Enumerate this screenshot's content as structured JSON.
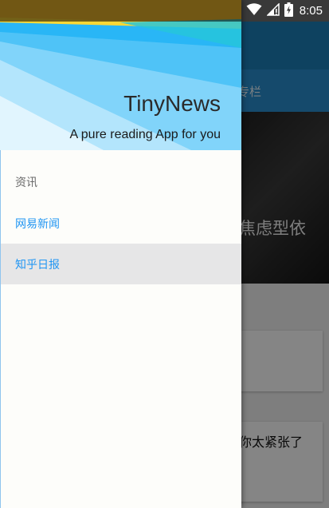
{
  "status_bar": {
    "time": "8:05",
    "icons": [
      "wifi-icon",
      "signal-icon",
      "battery-icon"
    ]
  },
  "background_app": {
    "tab_label": "专栏",
    "hero_title": "焦虑型依",
    "card_title": "你太紧张了"
  },
  "drawer": {
    "header": {
      "app_name": "TinyNews",
      "tagline": "A pure reading App for you"
    },
    "menu": {
      "section_title": "资讯",
      "items": [
        {
          "label": "网易新闻",
          "selected": false
        },
        {
          "label": "知乎日报",
          "selected": true
        }
      ]
    }
  },
  "colors": {
    "accent": "#2196f3",
    "selected_bg": "#e6e6e7",
    "toolbar": "#1c7fb8"
  }
}
